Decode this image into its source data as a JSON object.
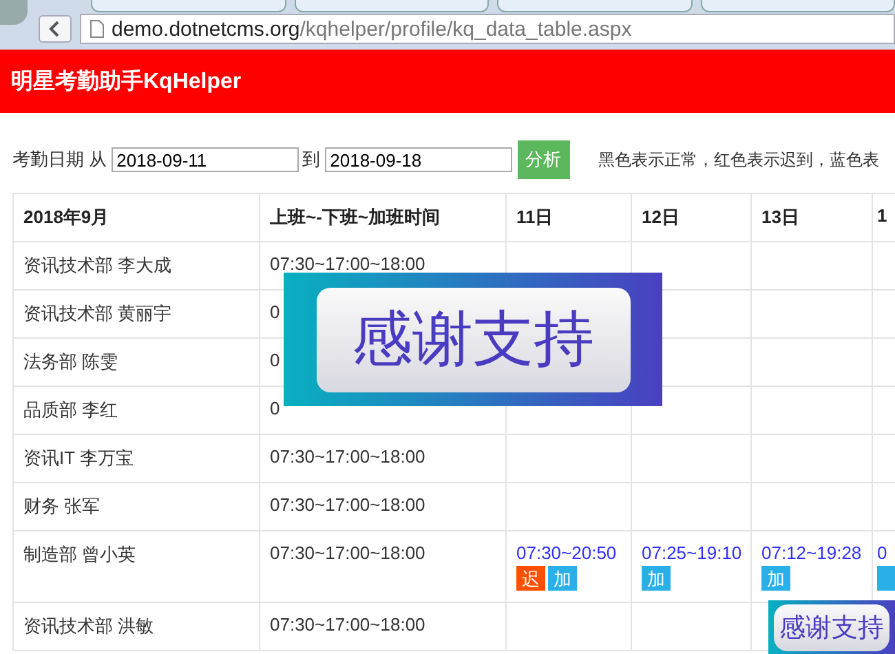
{
  "browser": {
    "url": "demo.dotnetcms.org/kqhelper/profile/kq_data_table.aspx"
  },
  "header": {
    "title": "明星考勤助手KqHelper"
  },
  "filter": {
    "label_from": "考勤日期 从",
    "from": "2018-09-11",
    "label_to": "到",
    "to": "2018-09-18",
    "button": "分析",
    "legend": "黑色表示正常，红色表示迟到，蓝色表"
  },
  "table": {
    "columns": [
      "2018年9月",
      "上班~-下班~加班时间",
      "11日",
      "12日",
      "13日",
      "1"
    ],
    "rows": [
      {
        "name": "资讯技术部 李大成",
        "schedule": "07:30~17:00~18:00"
      },
      {
        "name": "资讯技术部 黄丽宇",
        "schedule": "0"
      },
      {
        "name": "法务部 陈雯",
        "schedule": "0"
      },
      {
        "name": "品质部 李红",
        "schedule": "0"
      },
      {
        "name": "资讯IT 李万宝",
        "schedule": "07:30~17:00~18:00"
      },
      {
        "name": "财务 张军",
        "schedule": "07:30~17:00~18:00"
      },
      {
        "name": "制造部 曾小英",
        "schedule": "07:30~17:00~18:00",
        "days": [
          {
            "time": "07:30~20:50",
            "badges": [
              {
                "kind": "late",
                "label": "迟"
              },
              {
                "kind": "overtime",
                "label": "加"
              }
            ]
          },
          {
            "time": "07:25~19:10",
            "badges": [
              {
                "kind": "overtime",
                "label": "加"
              }
            ]
          },
          {
            "time": "07:12~19:28",
            "badges": [
              {
                "kind": "overtime",
                "label": "加"
              }
            ]
          },
          {
            "time": "0",
            "badges": [
              {
                "kind": "overtime"
              }
            ]
          }
        ]
      },
      {
        "name": "资讯技术部 洪敏",
        "schedule": "07:30~17:00~18:00"
      }
    ]
  },
  "banners": [
    {
      "text": "感谢支持"
    },
    {
      "text": "感谢支持"
    }
  ]
}
